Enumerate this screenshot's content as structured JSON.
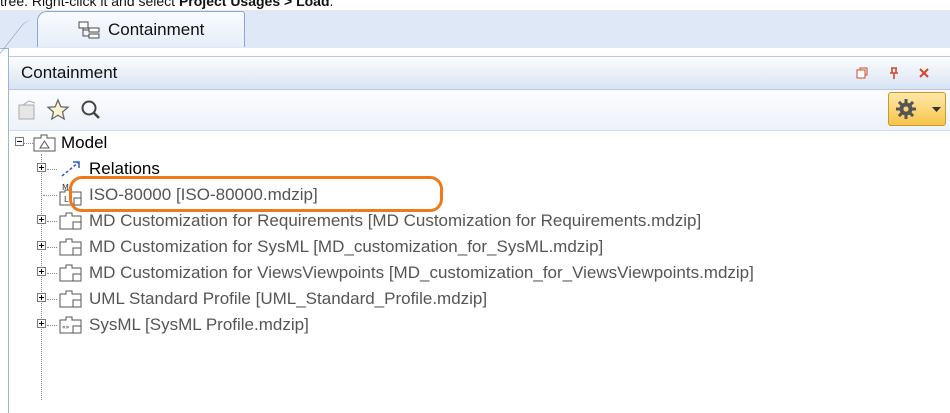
{
  "caption": {
    "prefix": "tree. Right-click it and select ",
    "menu_path": "Project Usages > Load",
    "suffix": "."
  },
  "tab": {
    "label": "Containment",
    "icon": "containment-tree-icon"
  },
  "panel": {
    "title": "Containment",
    "title_buttons": [
      "restore-icon",
      "pin-icon",
      "close-icon"
    ],
    "toolbar": [
      "add-diagram-icon",
      "favorite-star-icon",
      "search-icon"
    ],
    "options_button": "gear-icon"
  },
  "tree": {
    "root": {
      "label": "Model",
      "icon": "model-package-icon",
      "expanded": true
    },
    "items": [
      {
        "label": "Relations",
        "icon": "relations-icon",
        "expandable": true
      },
      {
        "label": "ISO-80000 [ISO-80000.mdzip]",
        "icon": "model-library-icon",
        "expandable": false,
        "highlighted": true,
        "greyed": true
      },
      {
        "label": "MD Customization for Requirements [MD Customization for Requirements.mdzip]",
        "icon": "shared-package-icon",
        "expandable": true,
        "greyed": true
      },
      {
        "label": "MD Customization for SysML [MD_customization_for_SysML.mdzip]",
        "icon": "shared-package-icon",
        "expandable": true,
        "greyed": true
      },
      {
        "label": "MD Customization for ViewsViewpoints [MD_customization_for_ViewsViewpoints.mdzip]",
        "icon": "shared-package-icon",
        "expandable": true,
        "greyed": true
      },
      {
        "label": "UML Standard Profile [UML_Standard_Profile.mdzip]",
        "icon": "shared-package-icon",
        "expandable": true,
        "greyed": true
      },
      {
        "label": "SysML [SysML Profile.mdzip]",
        "icon": "profile-icon",
        "expandable": true,
        "greyed": true
      }
    ]
  },
  "colors": {
    "highlight": "#f07a1a",
    "tab_bg": "#dfe8f6",
    "gear_btn": "#f7c44c"
  }
}
